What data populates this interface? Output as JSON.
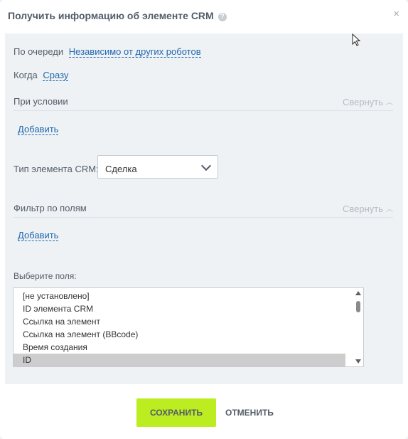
{
  "dialog": {
    "title": "Получить информацию об элементе CRM",
    "help_icon": "?",
    "close_icon": "×"
  },
  "queue": {
    "label": "По очереди",
    "value": "Независимо от других роботов"
  },
  "when": {
    "label": "Когда",
    "value": "Сразу"
  },
  "condition": {
    "label": "При условии",
    "collapse_label": "Свернуть",
    "add_label": "Добавить"
  },
  "crm_type": {
    "label": "Тип элемента CRM:",
    "value": "Сделка"
  },
  "filter": {
    "label": "Фильтр по полям",
    "collapse_label": "Свернуть",
    "add_label": "Добавить"
  },
  "fields": {
    "label": "Выберите поля:",
    "options": [
      "[не установлено]",
      "ID элемента CRM",
      "Ссылка на элемент",
      "Ссылка на элемент (BBcode)",
      "Время создания",
      "ID"
    ],
    "selected": "ID"
  },
  "footer": {
    "save_label": "СОХРАНИТЬ",
    "cancel_label": "ОТМЕНИТЬ"
  },
  "colors": {
    "accent": "#bbed21",
    "link": "#2067b0",
    "panel_bg": "#eef2f4"
  }
}
